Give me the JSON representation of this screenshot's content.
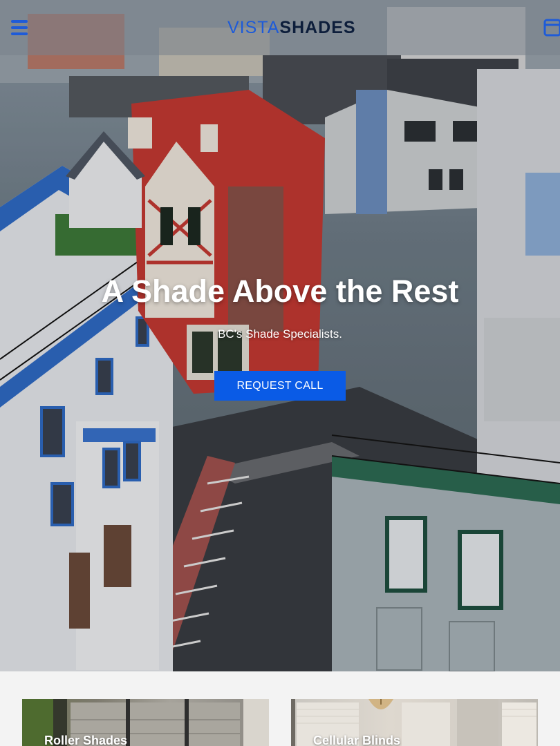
{
  "header": {
    "logo_part1": "VISTA",
    "logo_part2": "SHADES",
    "menu_icon": "hamburger-menu-icon",
    "cart_icon": "cart-icon",
    "accent_color": "#1e5bd8"
  },
  "hero": {
    "title": "A Shade Above the Rest",
    "subtitle": "BC's Shade Specialists.",
    "cta_label": "REQUEST CALL",
    "cta_color": "#0a5be6"
  },
  "products": {
    "items": [
      {
        "label": "Roller Shades"
      },
      {
        "label": "Cellular Blinds"
      }
    ]
  }
}
